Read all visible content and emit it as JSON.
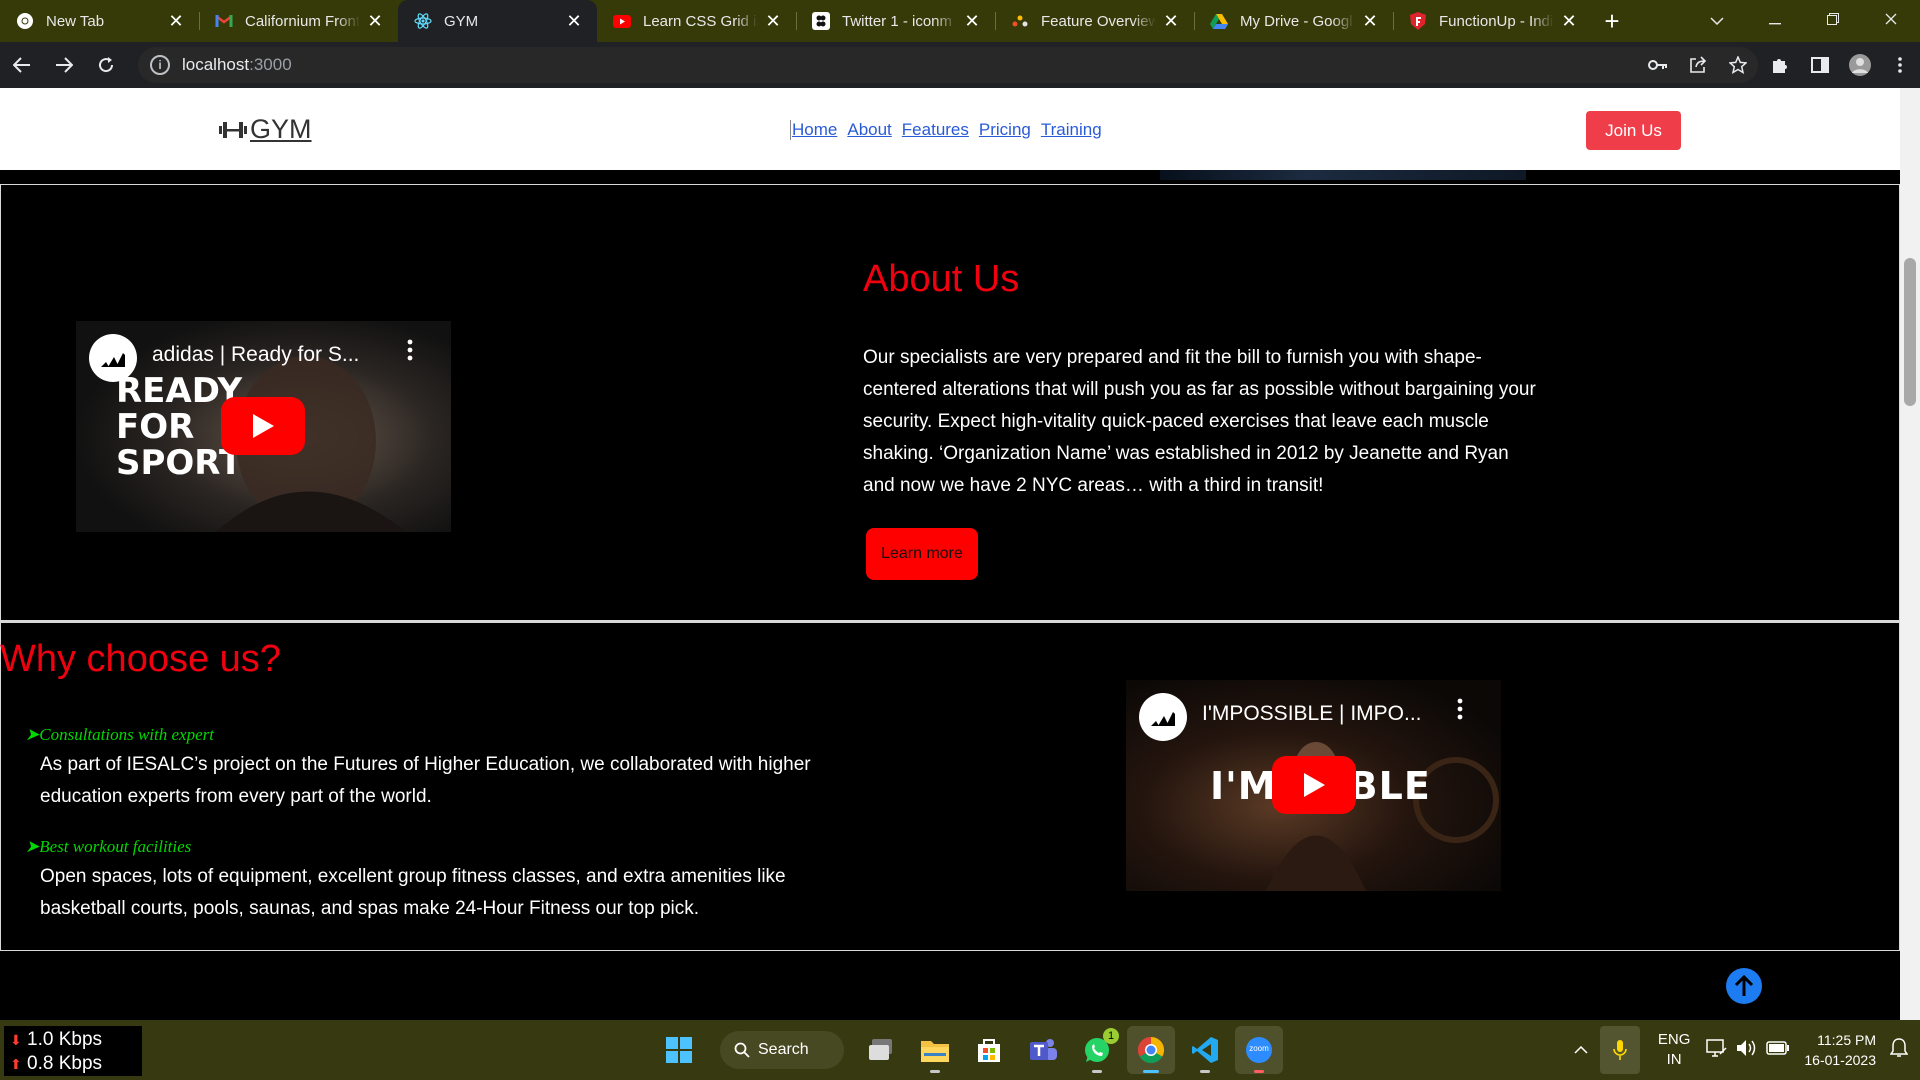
{
  "browser": {
    "tabs": [
      {
        "title": "New Tab",
        "icon": "chrome-icon",
        "active": false
      },
      {
        "title": "Californium Front",
        "icon": "gmail-icon",
        "active": false
      },
      {
        "title": "GYM",
        "icon": "react-icon",
        "active": true
      },
      {
        "title": "Learn CSS Grid in",
        "icon": "youtube-icon",
        "active": false
      },
      {
        "title": "Twitter 1 - iconm",
        "icon": "figma-icon",
        "active": false
      },
      {
        "title": "Feature Overview",
        "icon": "feature-icon",
        "active": false
      },
      {
        "title": "My Drive - Googl",
        "icon": "drive-icon",
        "active": false
      },
      {
        "title": "FunctionUp - Indi",
        "icon": "functionup-icon",
        "active": false
      }
    ],
    "close_glyph": "✕",
    "new_tab_glyph": "+",
    "url_host": "localhost",
    "url_port": ":3000"
  },
  "site": {
    "logo_text": "GYM",
    "nav": [
      "Home",
      "About",
      "Features",
      "Pricing",
      "Training"
    ],
    "join_label": "Join Us",
    "about": {
      "title": "About Us",
      "text": "Our specialists are very prepared and fit the bill to furnish you with shape-centered alterations that will push you as far as possible without bargaining your security. Expect high-vitality quick-paced exercises that leave each muscle shaking. ‘Organization Name’ was established in 2012 by Jeanette and Ryan and now we have 2 NYC areas… with a third in transit!",
      "button": "Learn more",
      "video": {
        "title": "adidas | Ready for S...",
        "overlay_lines": [
          "READY",
          "FOR",
          "SPORT"
        ]
      }
    },
    "why": {
      "title": "Why choose us?",
      "bullet": "➤",
      "features": [
        {
          "title": "Consultations with expert",
          "text": "As part of IESALC’s project on the Futures of Higher Education, we collaborated with higher education experts from every part of the world."
        },
        {
          "title": "Best workout facilities",
          "text": "Open spaces, lots of equipment, excellent group fitness classes, and extra amenities like basketball courts, pools, saunas, and spas make 24-Hour Fitness our top pick."
        }
      ],
      "video": {
        "title": "I'MPOSSIBLE | IMPO...",
        "overlay_text": "I'M    IBLE"
      }
    },
    "accent_color": "#f1010f",
    "feature_color": "#00d800",
    "join_color": "#ef3e4a"
  },
  "taskbar": {
    "net_down": "1.0 Kbps",
    "net_up": "0.8 Kbps",
    "search_label": "Search",
    "lang_top": "ENG",
    "lang_bottom": "IN",
    "time": "11:25 PM",
    "date": "16-01-2023",
    "whatsapp_badge": "1",
    "zoom_label": "zoom"
  }
}
